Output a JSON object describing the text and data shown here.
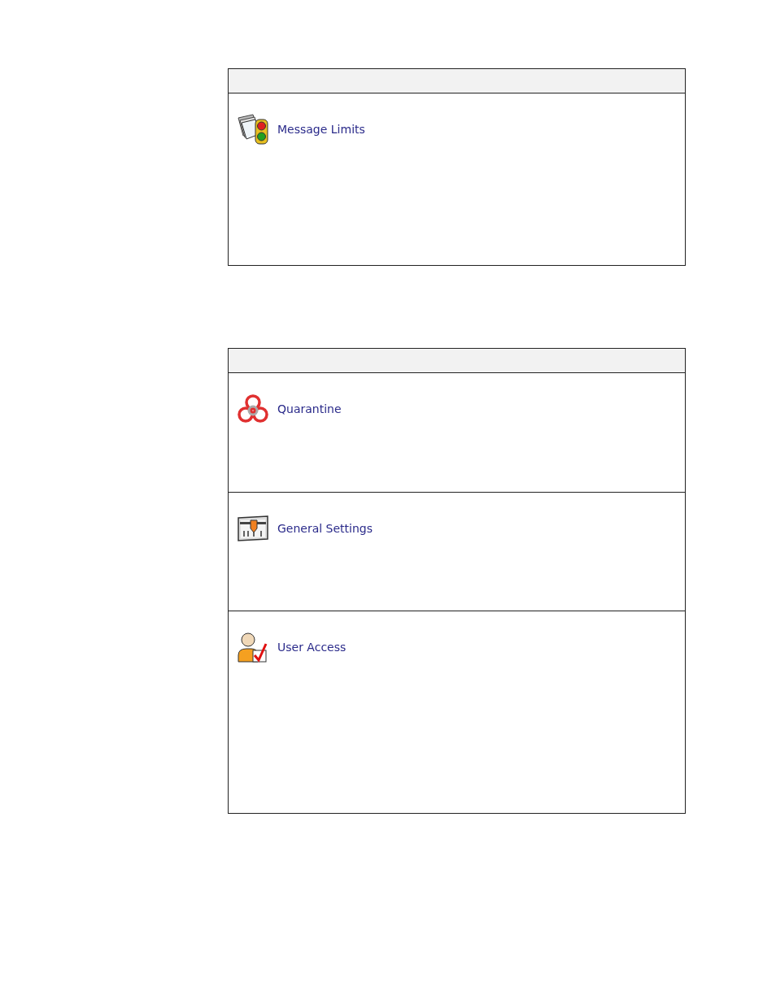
{
  "tables": [
    {
      "rows": [
        {
          "kind": "limits",
          "label": "Message Limits"
        }
      ]
    },
    {
      "rows": [
        {
          "kind": "quarantine",
          "label": "Quarantine"
        },
        {
          "kind": "settings",
          "label": "General Settings"
        },
        {
          "kind": "access",
          "label": "User Access"
        }
      ]
    }
  ]
}
